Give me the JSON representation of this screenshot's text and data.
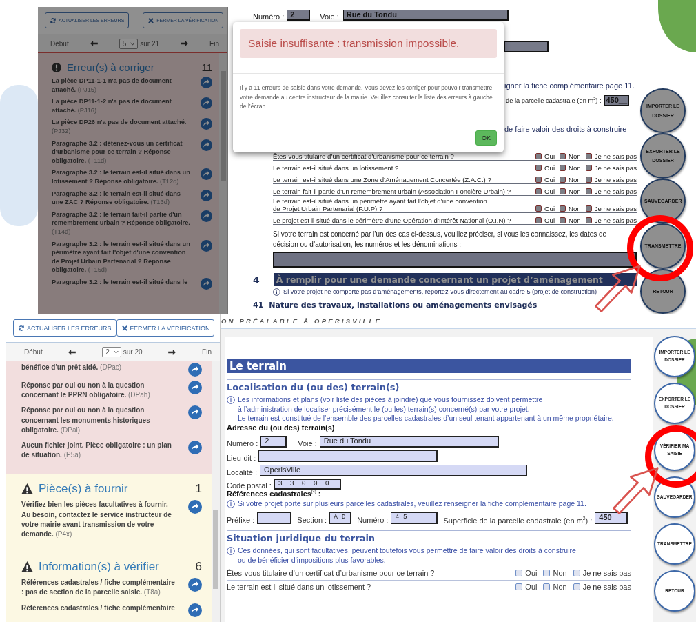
{
  "top_screen": {
    "sidebar": {
      "buttons": [
        {
          "kind": "refresh",
          "label": "ACTUALISER LES ERREURS"
        },
        {
          "kind": "close",
          "label": "FERMER LA VÉRIFICATION"
        }
      ],
      "pager": {
        "first": "Début",
        "page": "5",
        "total": "sur 21",
        "last": "Fin"
      },
      "sections": [
        {
          "kind": "error",
          "title": "Erreur(s) à corriger",
          "count": "11",
          "items": [
            {
              "message": "**La pièce DP11-1-1 n'a pas de document attaché.** (PJ15)"
            },
            {
              "message": "**La pièce DP11-1-2 n'a pas de document attaché.** (PJ16)"
            },
            {
              "message": "**La pièce DP26 n'a pas de document attaché.** (PJ32)"
            },
            {
              "message": "**Paragraphe 3.2 : détenez-vous un certificat d'urbanisme pour ce terrain ? Réponse obligatoire.** (T11d)"
            },
            {
              "message": "**Paragraphe 3.2 : le terrain est-il situé dans un lotissement ? Réponse obligatoire.** (T12d)"
            },
            {
              "message": "**Paragraphe 3.2 : le terrain est-il situé dans une ZAC ? Réponse obligatoire.** (T13d)"
            },
            {
              "message": "**Paragraphe 3.2 : le terrain fait-il partie d'un remembrement urbain ? Réponse obligatoire.** (T14d)"
            },
            {
              "message": "**Paragraphe 3.2 : le terrain est-il situé dans un périmètre ayant fait l'objet d'une convention de Projet Urbain Partenarial ? Réponse obligatoire.** (T15d)"
            },
            {
              "message": "**Paragraphe 3.2 : le terrain est-il situé dans le**"
            }
          ]
        }
      ]
    },
    "form": {
      "blocks": [
        {
          "kind": "address",
          "fields": [
            {
              "label": "Numéro :",
              "kind": "number",
              "value": "2"
            },
            {
              "label": "Voie :",
              "kind": "street",
              "value": "Rue du Tondu"
            }
          ]
        },
        {
          "kind": "field-tail"
        },
        {
          "kind": "info-tail",
          "text": "igner la fiche complémentaire page 11."
        },
        {
          "kind": "area-tail",
          "label": "de la parcelle cadastrale (en m$^{2}$) :",
          "value": "450__"
        },
        {
          "kind": "info-tail",
          "text": "de faire valoir des droits à construire"
        },
        {
          "kind": "question",
          "text": "Êtes-vous titulaire d’un certificat d’urbanisme pour ce terrain ?",
          "error": true,
          "options": [
            {
              "label": "Oui",
              "checked": false
            },
            {
              "label": "Non",
              "checked": false
            },
            {
              "label": "Je ne sais pas",
              "checked": false
            }
          ]
        },
        {
          "kind": "question",
          "text": "Le terrain est-il situé dans un lotissement ?",
          "error": true,
          "options": [
            {
              "label": "Oui",
              "checked": false
            },
            {
              "label": "Non",
              "checked": false
            },
            {
              "label": "Je ne sais pas",
              "checked": false
            }
          ]
        },
        {
          "kind": "question",
          "text": "Le terrain est-il situé dans une Zone d’Aménagement Concertée (Z.A.C.) ?",
          "error": true,
          "options": [
            {
              "label": "Oui",
              "checked": false
            },
            {
              "label": "Non",
              "checked": false
            },
            {
              "label": "Je ne sais pas",
              "checked": false
            }
          ]
        },
        {
          "kind": "question",
          "text": "Le terrain fait-il partie d’un remembrement urbain (Association Foncière Urbain) ?",
          "error": true,
          "options": [
            {
              "label": "Oui",
              "checked": false
            },
            {
              "label": "Non",
              "checked": false
            },
            {
              "label": "Je ne sais pas",
              "checked": false
            }
          ]
        },
        {
          "kind": "question",
          "text": "Le terrain est-il situé dans un périmètre ayant fait l’objet d’une convention\nde Projet Urbain Partenarial (P.U.P) ?",
          "error": true,
          "options": [
            {
              "label": "Oui",
              "checked": false
            },
            {
              "label": "Non",
              "checked": false
            },
            {
              "label": "Je ne sais pas",
              "checked": false
            }
          ]
        },
        {
          "kind": "question",
          "text": "Le projet est-il situé dans le périmètre d’une Opération d’Intérêt National (O.I.N) ?",
          "error": true,
          "options": [
            {
              "label": "Oui",
              "checked": false
            },
            {
              "label": "Non",
              "checked": false
            },
            {
              "label": "Je ne sais pas",
              "checked": false
            }
          ]
        },
        {
          "kind": "paragraph",
          "text": "Si votre terrain est concerné par l’un des cas ci-dessus, veuillez préciser, si vous les connaissez, les dates de décision ou d’autorisation, les numéros et les dénominations :"
        },
        {
          "kind": "textarea"
        },
        {
          "kind": "banner",
          "number": "4",
          "text": "À remplir pour une demande concernant un projet d’aménagement"
        },
        {
          "kind": "info",
          "text": "Si votre projet ne comporte pas d’aménagements, reportez-vous directement au cadre 5 (projet de construction)"
        },
        {
          "kind": "subsection",
          "number": "41",
          "text": "Nature des travaux, installations ou aménagements envisagés"
        }
      ]
    },
    "action_buttons": [
      {
        "label": "IMPORTER LE DOSSIER"
      },
      {
        "label": "EXPORTER LE DOSSIER"
      },
      {
        "label": "SAUVEGARDER"
      },
      {
        "label": "TRANSMETTRE"
      },
      {
        "label": "RETOUR"
      }
    ],
    "dialog": {
      "alert": "Saisie insuffisante : transmission impossible.",
      "message": "Il y a 11 erreurs de saisie dans votre demande. Vous devez les corriger pour pouvoir transmettre votre demande au centre instructeur de la mairie. Veuillez consulter la liste des erreurs à gauche de l’écran.",
      "button": "OK"
    }
  },
  "bottom_screen": {
    "sidebar": {
      "buttons": [
        {
          "kind": "refresh",
          "label": "ACTUALISER LES ERREURS"
        },
        {
          "kind": "close",
          "label": "FERMER LA VÉRIFICATION"
        }
      ],
      "pager": {
        "first": "Début",
        "page": "2",
        "total": "sur 20",
        "last": "Fin"
      },
      "sections": [
        {
          "kind": "error",
          "items": [
            {
              "message": "**bénéfice d'un prêt aidé.** (DPac)"
            },
            {
              "message": "**Réponse par oui ou non à la question concernant le PPRN obligatoire.** (DPah)"
            },
            {
              "message": "**Réponse par oui ou non à la question concernant les monuments historiques obligatoire.** (DPai)"
            },
            {
              "message": "**Aucun fichier joint. Pièce obligatoire : un plan de situation.** (P5a)"
            }
          ]
        },
        {
          "kind": "warning",
          "title": "Pièce(s) à fournir",
          "count": "1",
          "items": [
            {
              "message": "**Vérifiez bien les pièces facultatives à fournir. Au besoin, contactez le service instructeur de votre mairie avant transmission de votre demande.** (P4x)"
            }
          ]
        },
        {
          "kind": "warning",
          "title": "Information(s) à vérifier",
          "count": "6",
          "items": [
            {
              "message": "**Références cadastrales / fiche complémentaire : pas de section de la parcelle saisie.** (T8a)"
            },
            {
              "message": "**Références cadastrales / fiche complémentaire**"
            }
          ]
        }
      ]
    },
    "form_title": "ON PRÉALABLE À OPERISVILLE",
    "form": {
      "blocks": [
        {
          "kind": "banner",
          "text": "Le terrain"
        },
        {
          "kind": "subheading",
          "text": "Localisation du (ou des) terrain(s)"
        },
        {
          "kind": "info",
          "text": "Les informations et plans (voir liste des pièces à joindre) que vous fournissez doivent permettre\nà l’administration de localiser précisément le (ou les) terrain(s) concerné(s) par votre projet.\nLe terrain est constitué de l’ensemble des parcelles cadastrales d’un seul tenant appartenant à un même propriétaire."
        },
        {
          "kind": "label",
          "text": "Adresse du (ou des) terrain(s)"
        },
        {
          "kind": "address",
          "fields": [
            {
              "label": "Numéro :",
              "kind": "number",
              "value": "2"
            },
            {
              "label": "Voie :",
              "kind": "street",
              "value": "Rue du Tondu"
            }
          ]
        },
        {
          "kind": "address",
          "fields": [
            {
              "label": "Lieu-dit :",
              "kind": "place"
            }
          ]
        },
        {
          "kind": "address",
          "fields": [
            {
              "label": "Localité :",
              "kind": "locality",
              "value": "OperisVille"
            }
          ]
        },
        {
          "kind": "address",
          "fields": [
            {
              "label": "Code postal :",
              "kind": "postcode",
              "value": "33000"
            }
          ]
        },
        {
          "kind": "label",
          "text": "Références cadastrales$^{[4]}$ :"
        },
        {
          "kind": "info",
          "text": "Si votre projet porte sur plusieurs parcelles cadastrales, veuillez renseigner la fiche complémentaire page 11."
        },
        {
          "kind": "address",
          "fields": [
            {
              "label": "Préfixe :",
              "kind": "prefix"
            },
            {
              "label": "Section :",
              "kind": "section",
              "value": "AD"
            },
            {
              "label": "Numéro :",
              "kind": "parcel",
              "value": "45"
            },
            {
              "label": "Superficie de la parcelle cadastrale (en m$^{2}$) :",
              "kind": "area",
              "value": "450__"
            }
          ]
        },
        {
          "kind": "subheading",
          "text": "Situation juridique du terrain"
        },
        {
          "kind": "info",
          "text": "Ces données, qui sont facultatives, peuvent toutefois vous permettre de faire valoir des droits à construire\nou de bénéficier d’impositions plus favorables."
        },
        {
          "kind": "question",
          "text": "Êtes-vous titulaire d’un certificat d’urbanisme pour ce terrain ?",
          "error": false,
          "options": [
            {
              "label": "Oui",
              "checked": false
            },
            {
              "label": "Non",
              "checked": false
            },
            {
              "label": "Je ne sais pas",
              "checked": false
            }
          ]
        },
        {
          "kind": "question",
          "text": "Le terrain est-il situé dans un lotissement ?",
          "error": false,
          "options": [
            {
              "label": "Oui",
              "checked": false
            },
            {
              "label": "Non",
              "checked": false
            },
            {
              "label": "Je ne sais pas",
              "checked": false
            }
          ]
        }
      ]
    },
    "action_buttons": [
      {
        "label": "IMPORTER LE DOSSIER"
      },
      {
        "label": "EXPORTER LE DOSSIER"
      },
      {
        "label": "VÉRIFIER MA SAISIE"
      },
      {
        "label": "SAUVEGARDER"
      },
      {
        "label": "TRANSMETTRE"
      },
      {
        "label": "RETOUR"
      }
    ]
  }
}
